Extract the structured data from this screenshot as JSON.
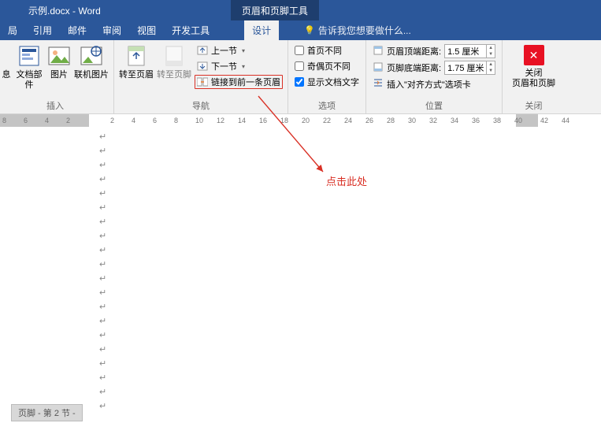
{
  "title": {
    "doc": "示例.docx - Word",
    "tool_tab": "页眉和页脚工具"
  },
  "tabs": {
    "t0": "局",
    "t1": "引用",
    "t2": "邮件",
    "t3": "审阅",
    "t4": "视图",
    "t5": "开发工具",
    "t6": "设计"
  },
  "tellme": {
    "placeholder": "告诉我您想要做什么..."
  },
  "insert": {
    "info": "息",
    "docparts": "文档部件",
    "picture": "图片",
    "online_pic": "联机图片",
    "label": "插入"
  },
  "nav": {
    "goto_header": "转至页眉",
    "goto_footer": "转至页脚",
    "prev": "上一节",
    "next": "下一节",
    "link_prev": "链接到前一条页眉",
    "label": "导航"
  },
  "options": {
    "diff_first": "首页不同",
    "diff_odd_even": "奇偶页不同",
    "show_doc": "显示文档文字",
    "label": "选项"
  },
  "position": {
    "header_top": "页眉顶端距离:",
    "footer_bottom": "页脚底端距离:",
    "val_top": "1.5 厘米",
    "val_bottom": "1.75 厘米",
    "insert_align": "插入\"对齐方式\"选项卡",
    "label": "位置"
  },
  "close": {
    "btn": "关闭\n页眉和页脚",
    "label": "关闭"
  },
  "annotation": {
    "text": "点击此处"
  },
  "footer_tab": "页脚 - 第 2 节 -",
  "ruler_nums": [
    "8",
    "6",
    "4",
    "2",
    "2",
    "4",
    "6",
    "8",
    "10",
    "12",
    "14",
    "16",
    "18",
    "20",
    "22",
    "24",
    "26",
    "28",
    "30",
    "32",
    "34",
    "36",
    "38",
    "40",
    "42",
    "44"
  ]
}
